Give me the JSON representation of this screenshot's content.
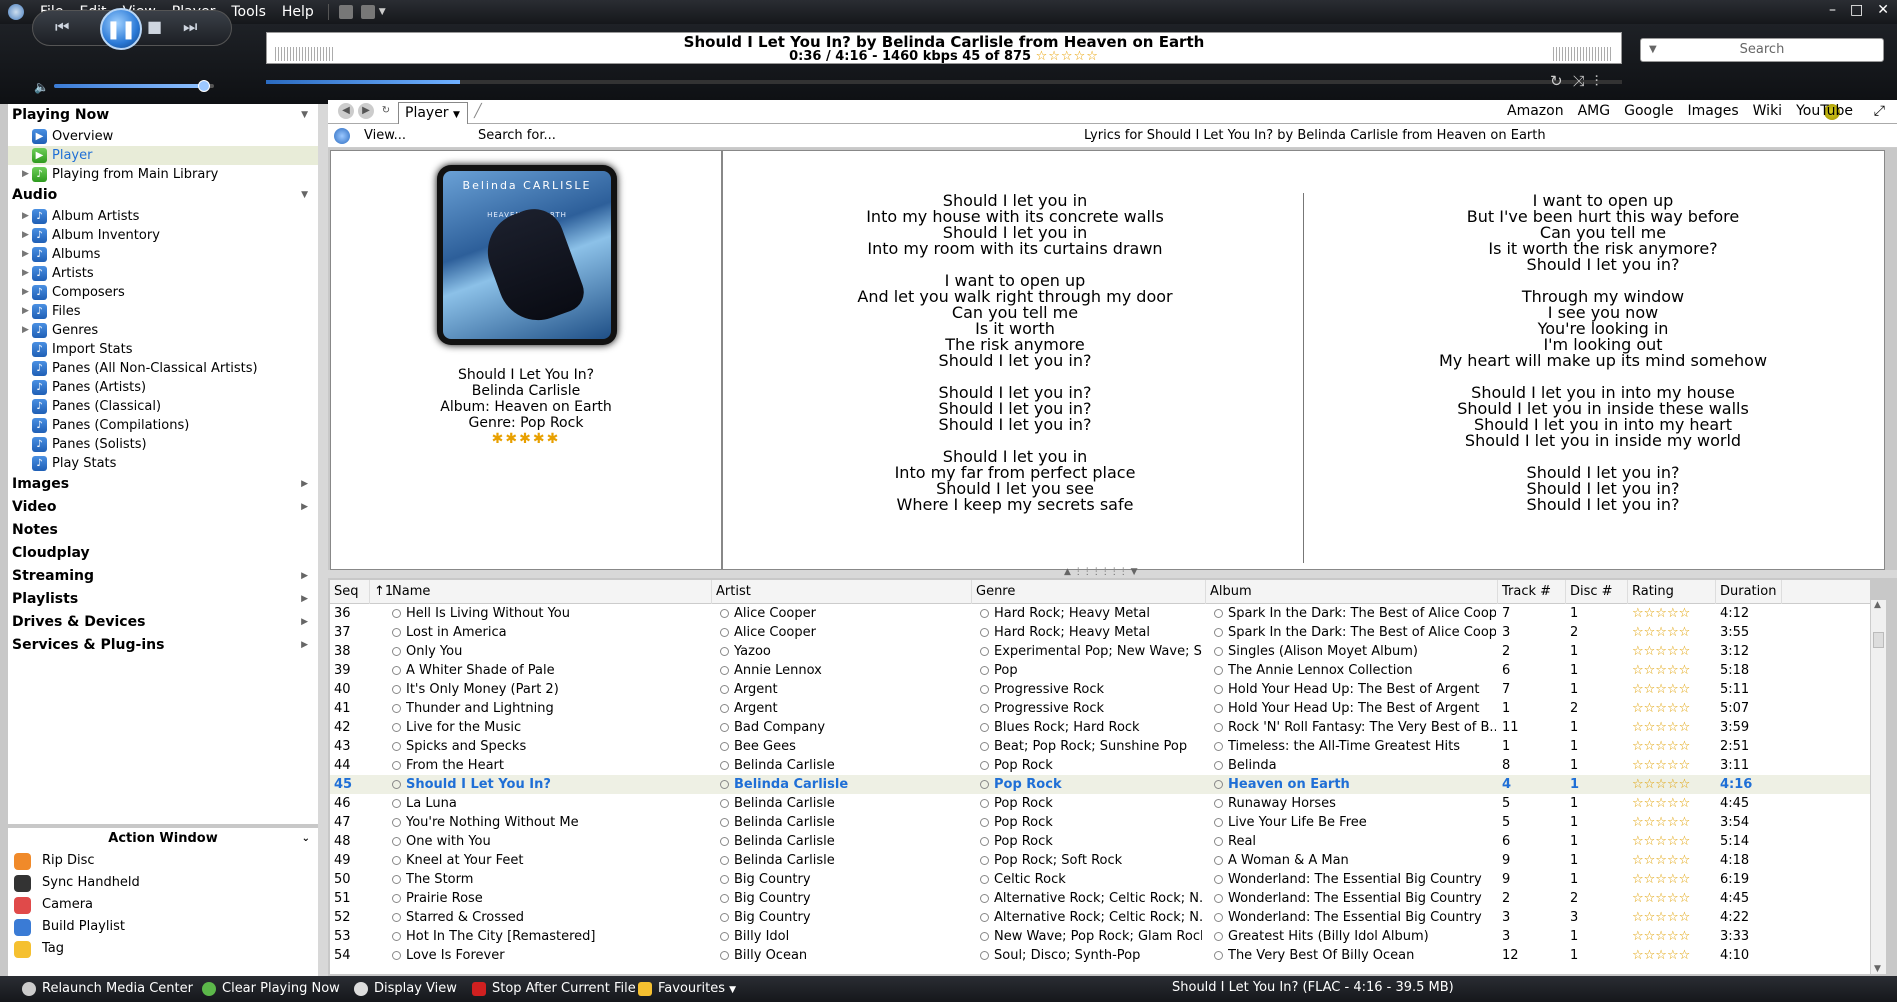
{
  "menu": [
    "File",
    "Edit",
    "View",
    "Player",
    "Tools",
    "Help"
  ],
  "now_playing": {
    "title": "Should I Let You In? by Belinda Carlisle from Heaven on Earth",
    "subtitle": "0:36 / 4:16 - 1460 kbps  45 of 875",
    "rating_stars": "☆☆☆☆☆",
    "progress_fraction": 0.143
  },
  "search": {
    "placeholder": "Search"
  },
  "sidebar": {
    "playing_now": {
      "label": "Playing Now",
      "items": [
        "Overview",
        "Player",
        "Playing from Main Library"
      ]
    },
    "audio": {
      "label": "Audio",
      "items": [
        "Album Artists",
        "Album Inventory",
        "Albums",
        "Artists",
        "Composers",
        "Files",
        "Genres",
        "Import Stats",
        "Panes (All Non-Classical Artists)",
        "Panes (Artists)",
        "Panes (Classical)",
        "Panes (Compilations)",
        "Panes (Solists)",
        "Play Stats"
      ]
    },
    "sections": [
      "Images",
      "Video",
      "Notes",
      "Cloudplay",
      "Streaming",
      "Playlists",
      "Drives & Devices",
      "Services & Plug-ins"
    ]
  },
  "action_window": {
    "title": "Action Window",
    "items": [
      "Rip Disc",
      "Sync Handheld",
      "Camera",
      "Build Playlist",
      "Tag"
    ]
  },
  "tabs": {
    "player": "Player"
  },
  "weblinks": [
    "Amazon",
    "AMG",
    "Google",
    "Images",
    "Wiki",
    "YouTube"
  ],
  "lyrics_bar": {
    "view": "View...",
    "search": "Search for...",
    "heading": "Lyrics for Should I Let You In? by Belinda Carlisle from Heaven on Earth"
  },
  "cover": {
    "text": "Belinda CARLISLE",
    "sub": "HEAVEN on EARTH"
  },
  "track_info": {
    "title": "Should I Let You In?",
    "artist": "Belinda Carlisle",
    "album": "Album: Heaven on Earth",
    "genre": "Genre: Pop Rock",
    "stars": "✱✱✱✱✱"
  },
  "lyrics_left": [
    "Should I let you in",
    "Into my house with its concrete walls",
    "Should I let you in",
    "Into my room with its curtains drawn",
    "",
    "I want to open up",
    "And let you walk right through my door",
    "Can you tell me",
    "Is it worth",
    "The risk anymore",
    "Should I let you in?",
    "",
    "Should I let you in?",
    "Should I let you in?",
    "Should I let you in?",
    "",
    "Should I let you in",
    "Into my far from perfect place",
    "Should I let you see",
    "Where I keep my secrets safe"
  ],
  "lyrics_right": [
    "I want to open up",
    "But I've been hurt this way before",
    "Can you tell me",
    "Is it worth the risk anymore?",
    "Should I let you in?",
    "",
    "Through my window",
    "I see you now",
    "You're looking in",
    "I'm looking out",
    "My heart will make up its mind somehow",
    "",
    "Should I let you in into my house",
    "Should I let you in inside these walls",
    "Should I let you in into my heart",
    "Should I let you in inside my world",
    "",
    "Should I let you in?",
    "Should I let you in?",
    "Should I let you in?"
  ],
  "table": {
    "headers": [
      "Seq",
      "↑1",
      "Name",
      "Artist",
      "Genre",
      "Album",
      "Track #",
      "Disc #",
      "Rating",
      "Duration"
    ],
    "rows": [
      [
        "36",
        "Hell Is Living Without You",
        "Alice Cooper",
        "Hard Rock; Heavy Metal",
        "Spark In the Dark: The Best of Alice Cooper",
        "7",
        "1",
        "4:12"
      ],
      [
        "37",
        "Lost in America",
        "Alice Cooper",
        "Hard Rock; Heavy Metal",
        "Spark In the Dark: The Best of Alice Cooper",
        "3",
        "2",
        "3:55"
      ],
      [
        "38",
        "Only You",
        "Yazoo",
        "Experimental Pop; New Wave; S...",
        "Singles (Alison Moyet Album)",
        "2",
        "1",
        "3:12"
      ],
      [
        "39",
        "A Whiter Shade of Pale",
        "Annie Lennox",
        "Pop",
        "The Annie Lennox Collection",
        "6",
        "1",
        "5:18"
      ],
      [
        "40",
        "It's Only Money (Part 2)",
        "Argent",
        "Progressive Rock",
        "Hold Your Head Up: The Best of Argent",
        "7",
        "1",
        "5:11"
      ],
      [
        "41",
        "Thunder and Lightning",
        "Argent",
        "Progressive Rock",
        "Hold Your Head Up: The Best of Argent",
        "1",
        "2",
        "5:07"
      ],
      [
        "42",
        "Live for the Music",
        "Bad Company",
        "Blues Rock; Hard Rock",
        "Rock 'N' Roll Fantasy: The Very Best of B...",
        "11",
        "1",
        "3:59"
      ],
      [
        "43",
        "Spicks and Specks",
        "Bee Gees",
        "Beat; Pop Rock; Sunshine Pop",
        "Timeless: the All-Time Greatest Hits",
        "1",
        "1",
        "2:51"
      ],
      [
        "44",
        "From the Heart",
        "Belinda Carlisle",
        "Pop Rock",
        "Belinda",
        "8",
        "1",
        "3:11"
      ],
      [
        "45",
        "Should I Let You In?",
        "Belinda Carlisle",
        "Pop Rock",
        "Heaven on Earth",
        "4",
        "1",
        "4:16"
      ],
      [
        "46",
        "La Luna",
        "Belinda Carlisle",
        "Pop Rock",
        "Runaway Horses",
        "5",
        "1",
        "4:45"
      ],
      [
        "47",
        "You're Nothing Without Me",
        "Belinda Carlisle",
        "Pop Rock",
        "Live Your Life Be Free",
        "5",
        "1",
        "3:54"
      ],
      [
        "48",
        "One with You",
        "Belinda Carlisle",
        "Pop Rock",
        "Real",
        "6",
        "1",
        "5:14"
      ],
      [
        "49",
        "Kneel at Your Feet",
        "Belinda Carlisle",
        "Pop Rock; Soft Rock",
        "A Woman & A Man",
        "9",
        "1",
        "4:18"
      ],
      [
        "50",
        "The Storm",
        "Big Country",
        "Celtic Rock",
        "Wonderland: The Essential Big Country",
        "9",
        "1",
        "6:19"
      ],
      [
        "51",
        "Prairie Rose",
        "Big Country",
        "Alternative Rock; Celtic Rock; N...",
        "Wonderland: The Essential Big Country",
        "2",
        "2",
        "4:45"
      ],
      [
        "52",
        "Starred & Crossed",
        "Big Country",
        "Alternative Rock; Celtic Rock; N...",
        "Wonderland: The Essential Big Country",
        "3",
        "3",
        "4:22"
      ],
      [
        "53",
        "Hot In The City [Remastered]",
        "Billy Idol",
        "New Wave; Pop Rock; Glam Rock",
        "Greatest Hits (Billy Idol Album)",
        "3",
        "1",
        "3:33"
      ],
      [
        "54",
        "Love Is Forever",
        "Billy Ocean",
        "Soul; Disco; Synth-Pop",
        "The Very Best Of Billy Ocean",
        "12",
        "1",
        "4:10"
      ]
    ],
    "current_seq": "45",
    "row_stars": "☆☆☆☆☆"
  },
  "statusbar": {
    "buttons": [
      "Relaunch Media Center",
      "Clear Playing Now",
      "Display View",
      "Stop After Current File",
      "Favourites"
    ],
    "status": "Should I Let You In? (FLAC - 4:16 - 39.5 MB)"
  },
  "colors": {
    "accent": "#1f6fd6",
    "star": "#e0a000",
    "dark": "#15171b"
  }
}
